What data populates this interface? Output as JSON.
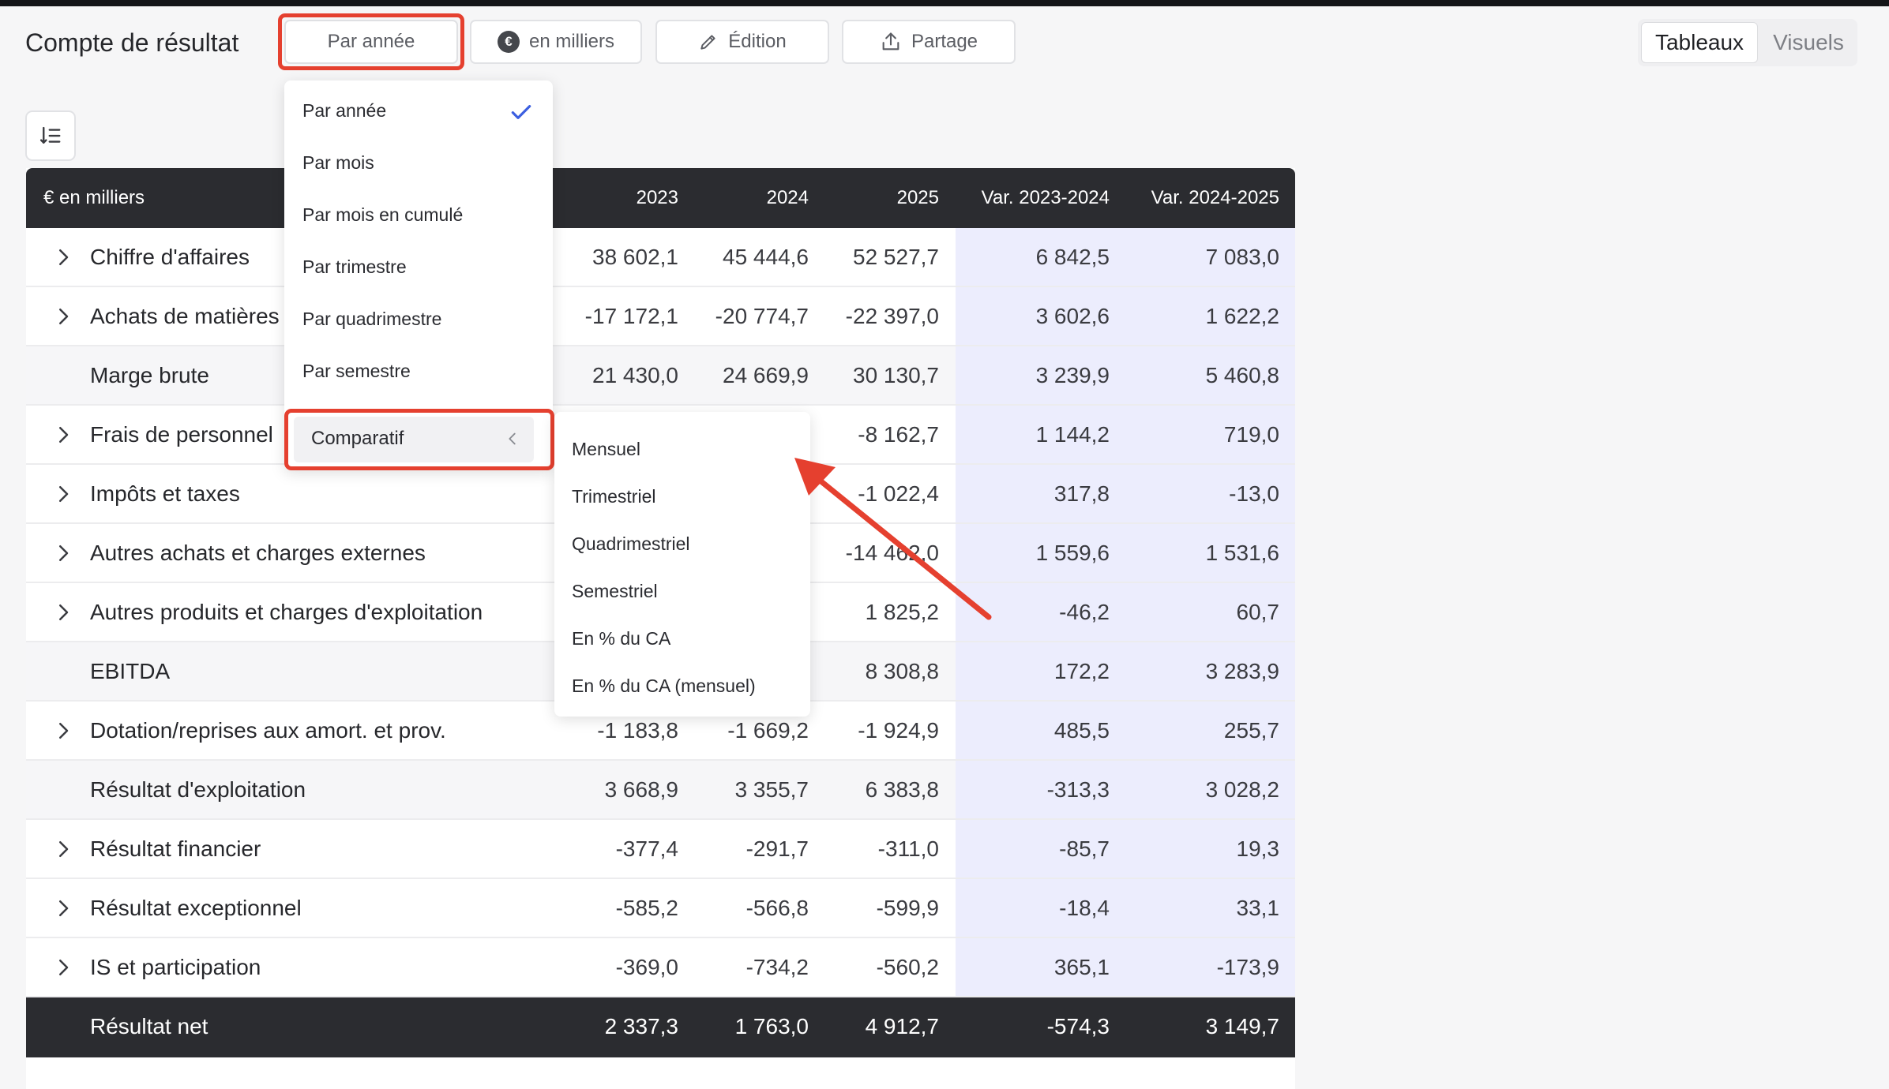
{
  "header": {
    "title": "Compte de résultat",
    "period_button": "Par année",
    "units_icon": "€",
    "units_button": "en milliers",
    "edit_button": "Édition",
    "share_button": "Partage",
    "view_tabs": [
      "Tableaux",
      "Visuels"
    ],
    "selected_view": "Tableaux"
  },
  "colors": {
    "accent_highlight": "#e5402f",
    "table_header": "#2b2c30",
    "variance_bg": "#ecedfd",
    "check": "#3c5fe0"
  },
  "table": {
    "columns": [
      "€ en milliers",
      "2023",
      "2024",
      "2025",
      "Var. 2023-2024",
      "Var. 2024-2025"
    ],
    "rows": [
      {
        "label": "Chiffre d'affaires",
        "expandable": true,
        "kind": "normal",
        "values": [
          "38 602,1",
          "45 444,6",
          "52 527,7",
          "6 842,5",
          "7 083,0"
        ]
      },
      {
        "label": "Achats de matières",
        "expandable": true,
        "kind": "normal",
        "values": [
          "-17 172,1",
          "-20 774,7",
          "-22 397,0",
          "3 602,6",
          "1 622,2"
        ]
      },
      {
        "label": "Marge brute",
        "expandable": false,
        "kind": "total",
        "values": [
          "21 430,0",
          "24 669,9",
          "30 130,7",
          "3 239,9",
          "5 460,8"
        ]
      },
      {
        "label": "Frais de personnel",
        "expandable": true,
        "kind": "normal",
        "values": [
          "",
          "",
          "-8 162,7",
          "1 144,2",
          "719,0"
        ]
      },
      {
        "label": "Impôts et taxes",
        "expandable": true,
        "kind": "normal",
        "values": [
          "",
          "",
          "-1 022,4",
          "317,8",
          "-13,0"
        ]
      },
      {
        "label": "Autres achats et charges externes",
        "expandable": true,
        "kind": "normal",
        "values": [
          "",
          "",
          "-14 462,0",
          "1 559,6",
          "1 531,6"
        ]
      },
      {
        "label": "Autres produits et charges d'exploitation",
        "expandable": true,
        "kind": "normal",
        "values": [
          "",
          "",
          "1 825,2",
          "-46,2",
          "60,7"
        ]
      },
      {
        "label": "EBITDA",
        "expandable": false,
        "kind": "total",
        "values": [
          "",
          "",
          "8 308,8",
          "172,2",
          "3 283,9"
        ]
      },
      {
        "label": "Dotation/reprises aux amort. et prov.",
        "expandable": true,
        "kind": "normal",
        "values": [
          "-1 183,8",
          "-1 669,2",
          "-1 924,9",
          "485,5",
          "255,7"
        ]
      },
      {
        "label": "Résultat d'exploitation",
        "expandable": false,
        "kind": "total",
        "values": [
          "3 668,9",
          "3 355,7",
          "6 383,8",
          "-313,3",
          "3 028,2"
        ]
      },
      {
        "label": "Résultat financier",
        "expandable": true,
        "kind": "normal",
        "values": [
          "-377,4",
          "-291,7",
          "-311,0",
          "-85,7",
          "19,3"
        ]
      },
      {
        "label": "Résultat exceptionnel",
        "expandable": true,
        "kind": "normal",
        "values": [
          "-585,2",
          "-566,8",
          "-599,9",
          "-18,4",
          "33,1"
        ]
      },
      {
        "label": "IS et participation",
        "expandable": true,
        "kind": "normal",
        "values": [
          "-369,0",
          "-734,2",
          "-560,2",
          "365,1",
          "-173,9"
        ]
      },
      {
        "label": "Résultat net",
        "expandable": false,
        "kind": "net",
        "values": [
          "2 337,3",
          "1 763,0",
          "4 912,7",
          "-574,3",
          "3 149,7"
        ]
      }
    ]
  },
  "period_menu": {
    "items": [
      "Par année",
      "Par mois",
      "Par mois en cumulé",
      "Par trimestre",
      "Par quadrimestre",
      "Par semestre"
    ],
    "selected": "Par année",
    "submenu_label": "Comparatif",
    "submenu_items": [
      "Mensuel",
      "Trimestriel",
      "Quadrimestriel",
      "Semestriel",
      "En % du CA",
      "En % du CA (mensuel)"
    ]
  }
}
